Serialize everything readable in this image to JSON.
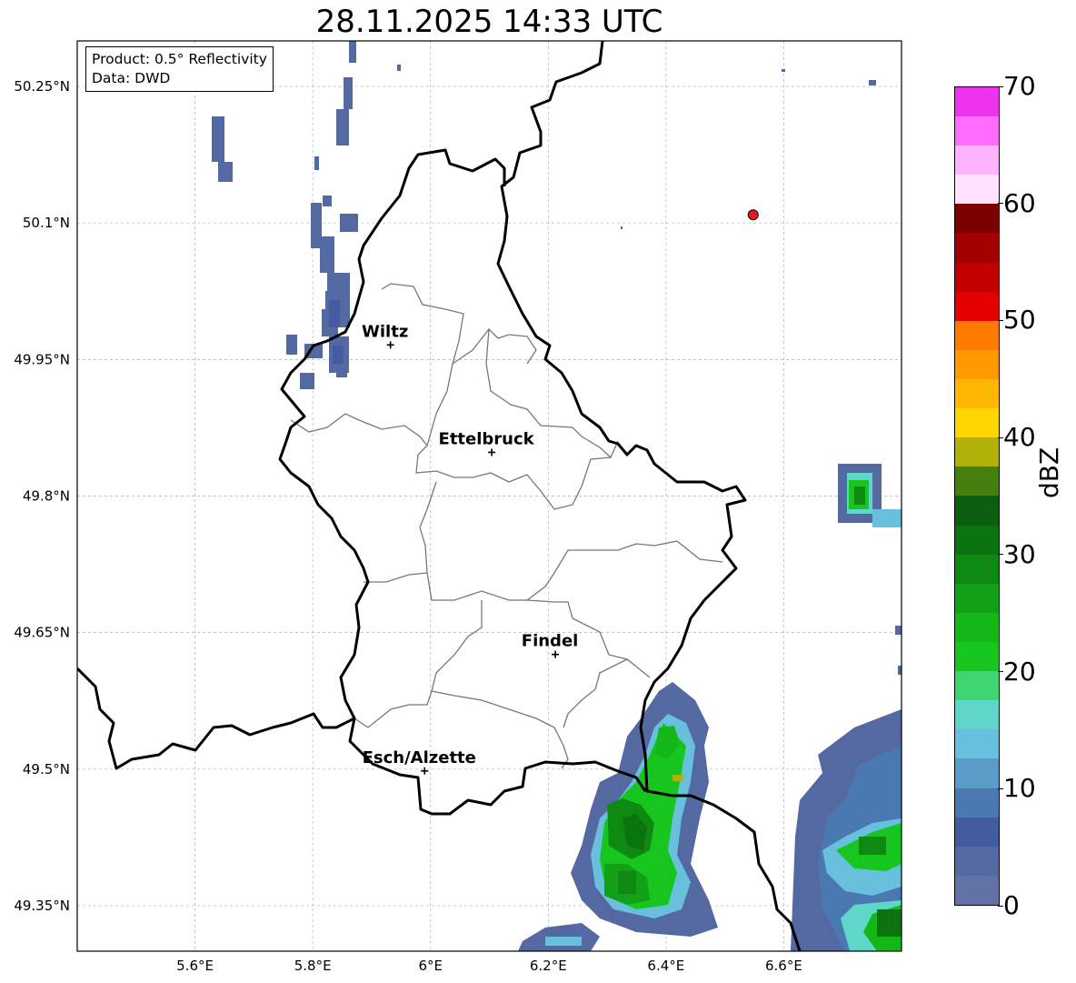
{
  "title": "28.11.2025 14:33 UTC",
  "info": {
    "product": "Product: 0.5° Reflectivity",
    "source": "Data: DWD"
  },
  "map": {
    "lon_range": [
      5.4,
      6.8
    ],
    "lat_range": [
      49.3,
      50.3
    ],
    "lon_ticks": [
      "5.6°E",
      "5.8°E",
      "6°E",
      "6.2°E",
      "6.4°E",
      "6.6°E"
    ],
    "lat_ticks": [
      "50.25°N",
      "50.1°N",
      "49.95°N",
      "49.8°N",
      "49.65°N",
      "49.5°N",
      "49.35°N"
    ],
    "cities": [
      {
        "name": "Wiltz",
        "lon": 5.932,
        "lat": 49.966
      },
      {
        "name": "Ettelbruck",
        "lon": 6.104,
        "lat": 49.848
      },
      {
        "name": "Findel",
        "lon": 6.212,
        "lat": 49.626
      },
      {
        "name": "Esch/Alzette",
        "lon": 5.99,
        "lat": 49.498
      }
    ],
    "radar_site": {
      "lon": 6.548,
      "lat": 50.109,
      "color": "#e31a1c"
    }
  },
  "colorbar": {
    "label": "dBZ",
    "ticks": [
      "0",
      "10",
      "20",
      "30",
      "40",
      "50",
      "60",
      "70"
    ],
    "colors": [
      "#6272a4",
      "#5468a2",
      "#435ca0",
      "#4a78b0",
      "#5a9cc8",
      "#68c0dc",
      "#5ed6c8",
      "#3fd56e",
      "#16c51d",
      "#13b818",
      "#12a116",
      "#0e8912",
      "#0b7410",
      "#0a5e0d",
      "#467f0e",
      "#b0b20a",
      "#ffd700",
      "#ffb700",
      "#ff9a00",
      "#ff7b00",
      "#e50000",
      "#c20000",
      "#a00000",
      "#7a0000",
      "#ffe0ff",
      "#ffb3ff",
      "#ff6cff",
      "#ee33ee"
    ]
  }
}
